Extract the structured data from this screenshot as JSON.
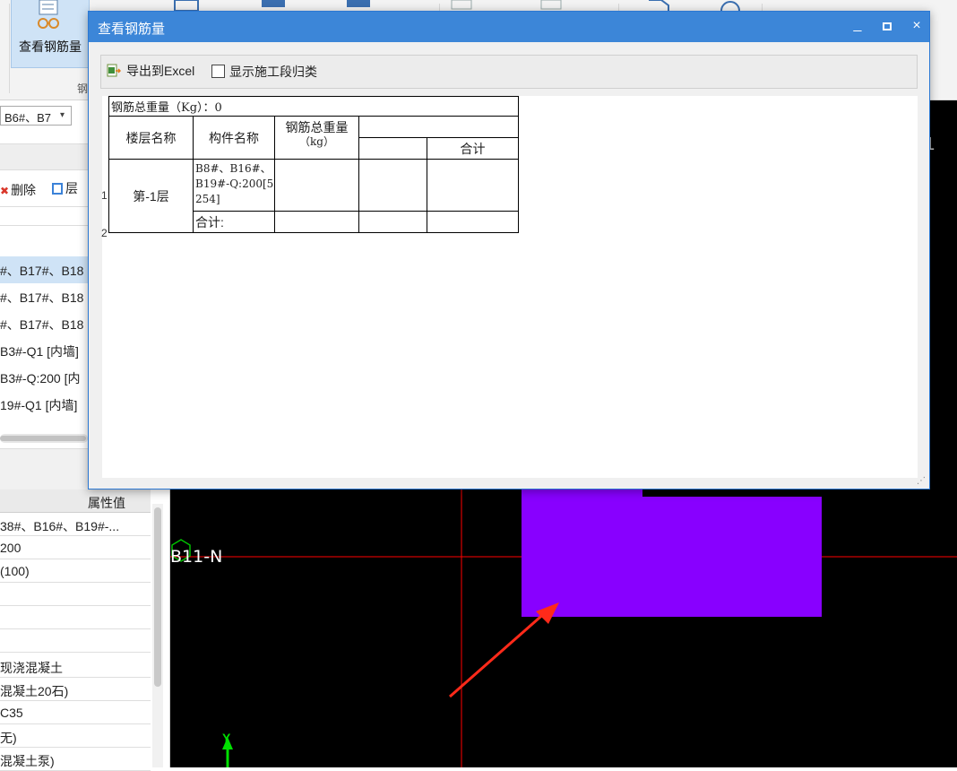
{
  "ribbon": {
    "active_button_label": "查看钢筋量",
    "group_label": "钢"
  },
  "left_panel": {
    "floor_combo_value": "B6#、B7",
    "toolbar": {
      "delete_label": "删除",
      "layer_label": "层"
    },
    "component_items": [
      "#、B17#、B18",
      "#、B17#、B18",
      "#、B17#、B18",
      "B3#-Q1 [内墙]",
      "B3#-Q:200 [内",
      "19#-Q1 [内墙]"
    ],
    "properties": {
      "header": "属性值",
      "rows": [
        "38#、B16#、B19#-...",
        "200",
        "(100)",
        "",
        "",
        "现浇混凝土",
        "混凝土20石)",
        "C35",
        "无)",
        "混凝土泵)"
      ]
    }
  },
  "canvas": {
    "axis_label": "B11-N",
    "top_right_text": "1",
    "y_axis_label": "Y",
    "colors": {
      "background": "#000000",
      "axis_line": "#ff0000",
      "slab": "#8800ff",
      "arrow": "#ff2a1a",
      "ucs": "#00e000"
    }
  },
  "dialog": {
    "title": "查看钢筋量",
    "controls": {
      "minimize": "_",
      "maximize": "□",
      "close": "×"
    },
    "export_label": "导出到Excel",
    "show_segment_label": "显示施工段归类",
    "show_segment_checked": false,
    "report": {
      "total_weight": "钢筋总重量（Kg）：0",
      "col_floor": "楼层名称",
      "col_component": "构件名称",
      "col_total_line1": "钢筋总重量",
      "col_total_line2": "（kg）",
      "col_subtotal": "合计",
      "rows": [
        {
          "row_no": "1",
          "floor": "第-1层",
          "component": "B8#、B16#、B19#-Q:200[5254]"
        },
        {
          "row_no": "2",
          "component": "合计:"
        }
      ]
    }
  }
}
